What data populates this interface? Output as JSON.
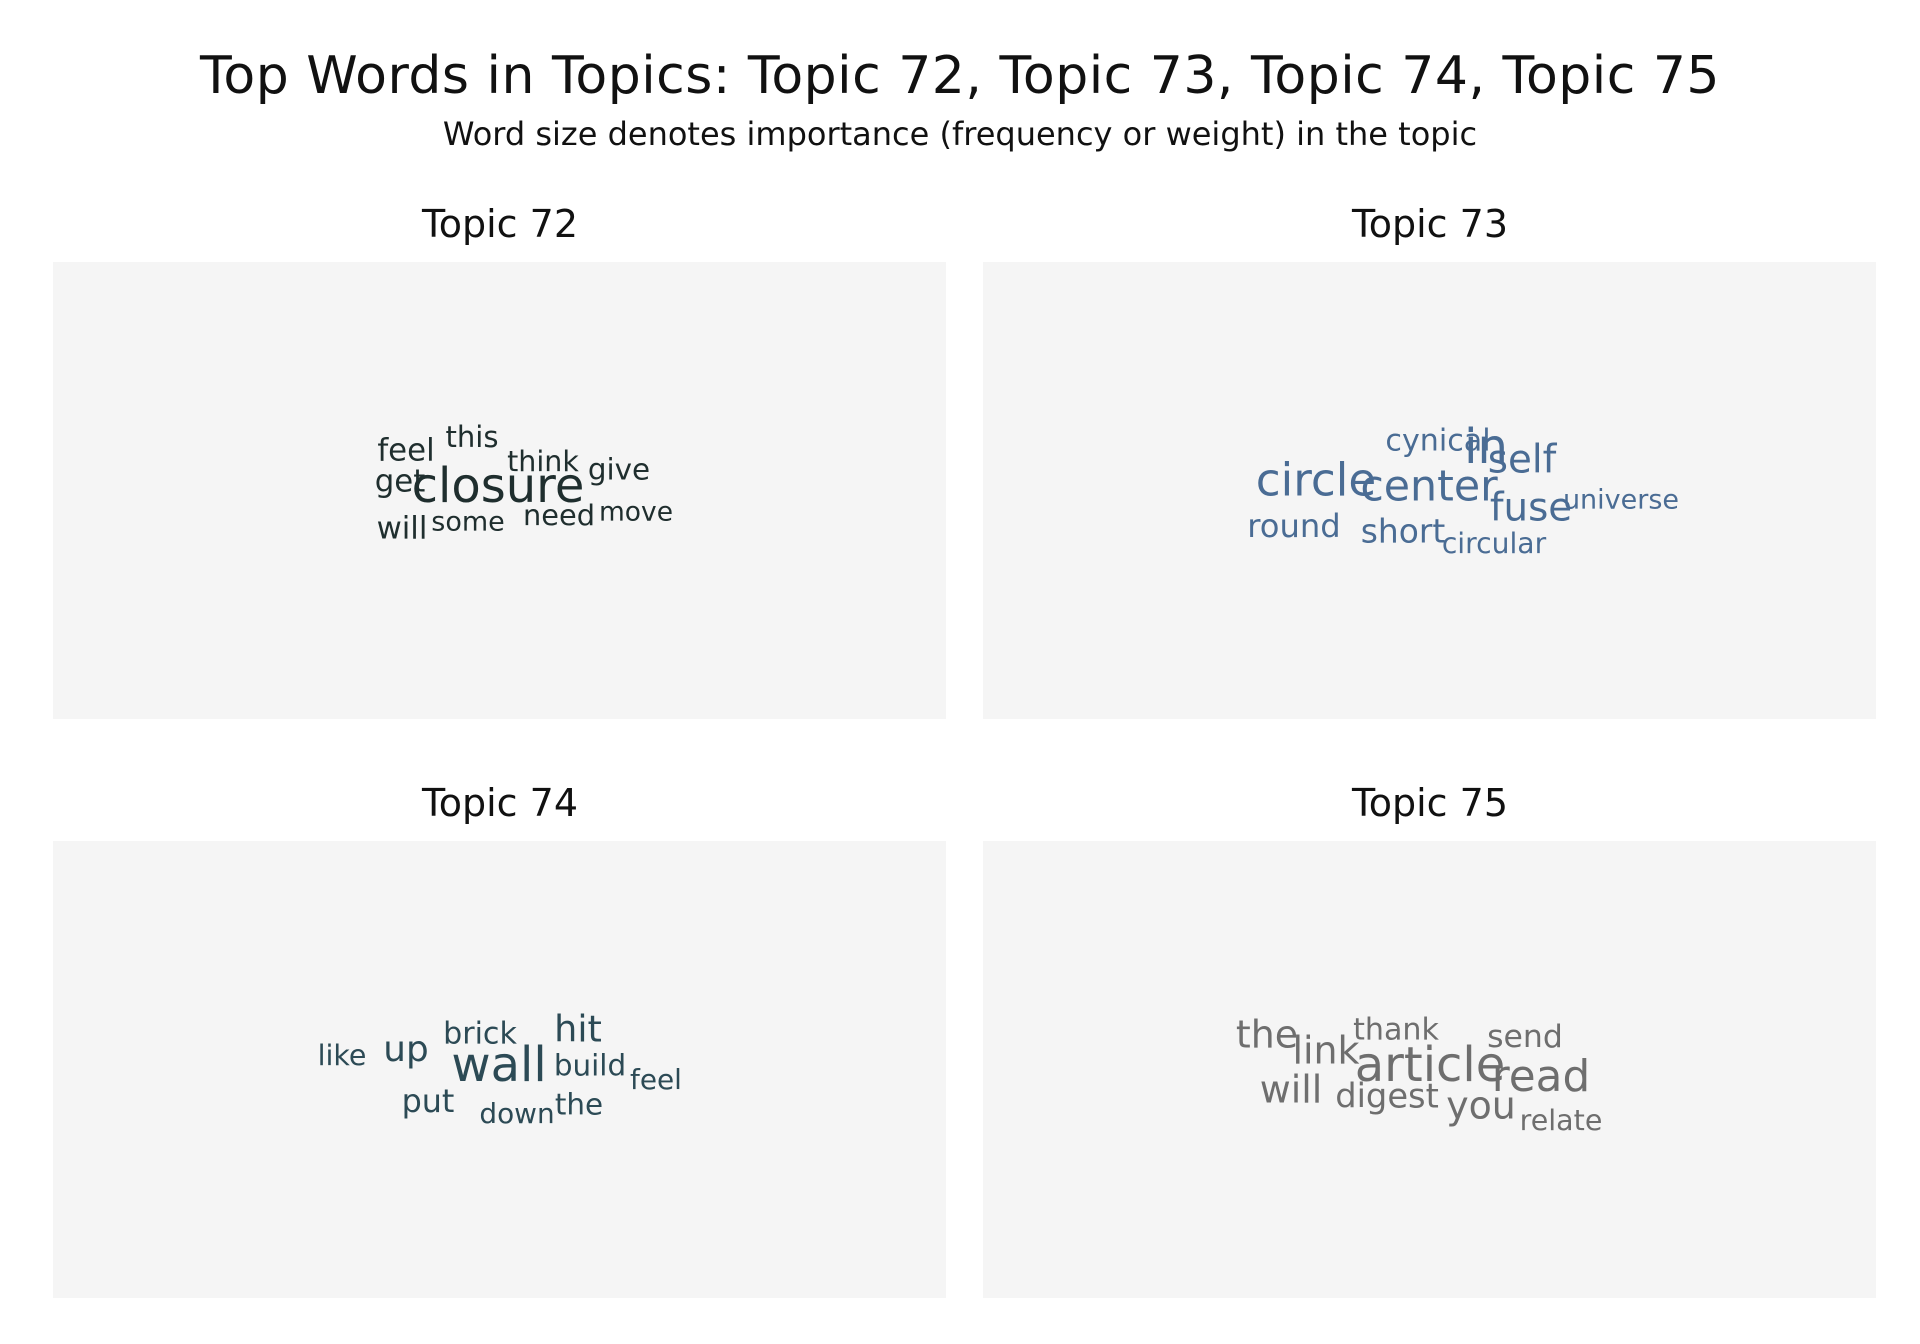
{
  "title": "Top Words in Topics: Topic 72, Topic 73, Topic 74, Topic 75",
  "subtitle": "Word size denotes importance (frequency or weight) in the topic",
  "chart_data": [
    {
      "type": "wordcloud",
      "title": "Topic 72",
      "color": "#1f2e2e",
      "words": [
        {
          "text": "closure",
          "weight": 1.0
        },
        {
          "text": "get",
          "weight": 0.62
        },
        {
          "text": "feel",
          "weight": 0.62
        },
        {
          "text": "will",
          "weight": 0.62
        },
        {
          "text": "give",
          "weight": 0.58
        },
        {
          "text": "this",
          "weight": 0.57
        },
        {
          "text": "need",
          "weight": 0.56
        },
        {
          "text": "think",
          "weight": 0.55
        },
        {
          "text": "some",
          "weight": 0.5
        },
        {
          "text": "move",
          "weight": 0.48
        }
      ]
    },
    {
      "type": "wordcloud",
      "title": "Topic 73",
      "color": "#4a6c94",
      "words": [
        {
          "text": "in",
          "weight": 1.0
        },
        {
          "text": "circle",
          "weight": 0.95
        },
        {
          "text": "center",
          "weight": 0.9
        },
        {
          "text": "self",
          "weight": 0.82
        },
        {
          "text": "fuse",
          "weight": 0.82
        },
        {
          "text": "short",
          "weight": 0.68
        },
        {
          "text": "round",
          "weight": 0.66
        },
        {
          "text": "cynical",
          "weight": 0.6
        },
        {
          "text": "circular",
          "weight": 0.54
        },
        {
          "text": "universe",
          "weight": 0.5
        }
      ]
    },
    {
      "type": "wordcloud",
      "title": "Topic 74",
      "color": "#2c4a55",
      "words": [
        {
          "text": "wall",
          "weight": 1.0
        },
        {
          "text": "hit",
          "weight": 0.77
        },
        {
          "text": "up",
          "weight": 0.75
        },
        {
          "text": "put",
          "weight": 0.65
        },
        {
          "text": "brick",
          "weight": 0.6
        },
        {
          "text": "build",
          "weight": 0.58
        },
        {
          "text": "the",
          "weight": 0.58
        },
        {
          "text": "like",
          "weight": 0.55
        },
        {
          "text": "feel",
          "weight": 0.53
        },
        {
          "text": "down",
          "weight": 0.53
        }
      ]
    },
    {
      "type": "wordcloud",
      "title": "Topic 75",
      "color": "#6e6e6e",
      "words": [
        {
          "text": "article",
          "weight": 1.0
        },
        {
          "text": "read",
          "weight": 0.92
        },
        {
          "text": "link",
          "weight": 0.8
        },
        {
          "text": "the",
          "weight": 0.8
        },
        {
          "text": "will",
          "weight": 0.8
        },
        {
          "text": "you",
          "weight": 0.8
        },
        {
          "text": "digest",
          "weight": 0.7
        },
        {
          "text": "send",
          "weight": 0.64
        },
        {
          "text": "thank",
          "weight": 0.6
        },
        {
          "text": "relate",
          "weight": 0.55
        }
      ]
    }
  ]
}
